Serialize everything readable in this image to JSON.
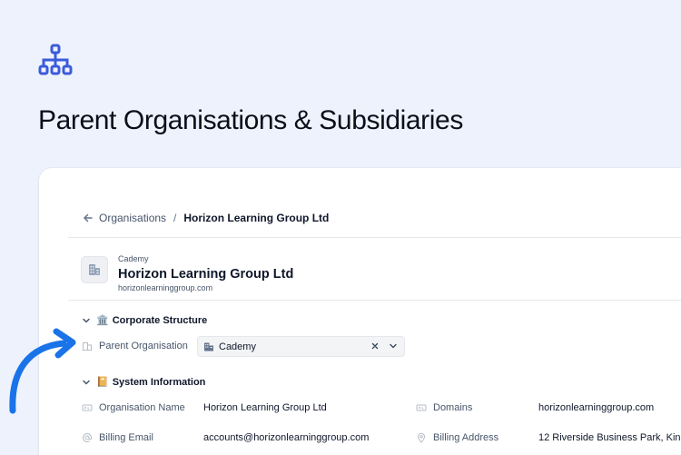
{
  "title": "Parent Organisations & Subsidiaries",
  "icons": {
    "feature": "hierarchy-icon",
    "back": "arrow-left-icon",
    "org": "building-icon",
    "pointer": "curved-arrow-icon"
  },
  "colors": {
    "accent": "#3b5bdb",
    "pointer": "#1a73e8",
    "background": "#eef2fc"
  },
  "breadcrumb": {
    "parent": "Organisations",
    "separator": "/",
    "current": "Horizon Learning Group Ltd"
  },
  "org": {
    "parent_label": "Cademy",
    "name": "Horizon Learning Group Ltd",
    "domain": "horizonlearninggroup.com"
  },
  "sections": {
    "corporate": {
      "title": "Corporate Structure",
      "emoji": "🏛️",
      "parent_org_label": "Parent Organisation",
      "parent_org_value": "Cademy"
    },
    "system": {
      "title": "System Information",
      "emoji": "📔",
      "fields": {
        "org_name_label": "Organisation Name",
        "org_name_value": "Horizon Learning Group Ltd",
        "domains_label": "Domains",
        "domains_value": "horizonlearninggroup.com",
        "billing_email_label": "Billing Email",
        "billing_email_value": "accounts@horizonlearninggroup.com",
        "billing_address_label": "Billing Address",
        "billing_address_value": "12 Riverside Business Park, Kin"
      }
    }
  }
}
